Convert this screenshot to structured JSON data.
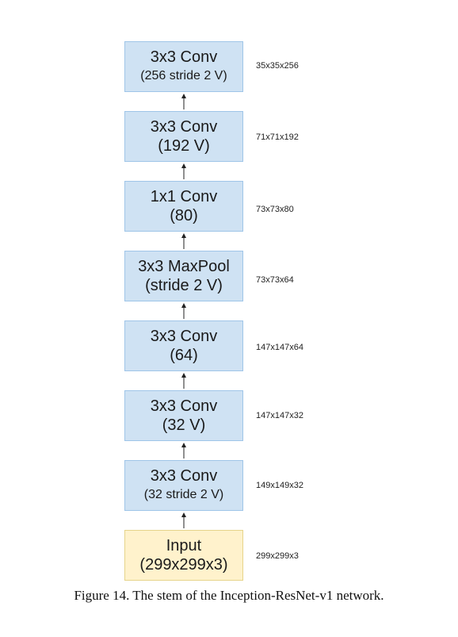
{
  "layers": [
    {
      "line1": "3x3 Conv",
      "line2": "(256 stride 2 V)",
      "dims": "35x35x256"
    },
    {
      "line1": "3x3 Conv",
      "line2": "(192 V)",
      "dims": "71x71x192"
    },
    {
      "line1": "1x1 Conv",
      "line2": "(80)",
      "dims": "73x73x80"
    },
    {
      "line1": "3x3 MaxPool",
      "line2": "(stride 2 V)",
      "dims": "73x73x64"
    },
    {
      "line1": "3x3 Conv",
      "line2": "(64)",
      "dims": "147x147x64"
    },
    {
      "line1": "3x3 Conv",
      "line2": "(32 V)",
      "dims": "147x147x32"
    },
    {
      "line1": "3x3 Conv",
      "line2": "(32 stride 2 V)",
      "dims": "149x149x32"
    },
    {
      "line1": "Input",
      "line2": "(299x299x3)",
      "dims": "299x299x3"
    }
  ],
  "caption": "Figure 14. The stem of the Inception-ResNet-v1 network.",
  "colors": {
    "layer_fill": "#cfe2f3",
    "layer_border": "#9fc5e8",
    "input_fill": "#fff2cc",
    "input_border": "#e6d48a"
  }
}
